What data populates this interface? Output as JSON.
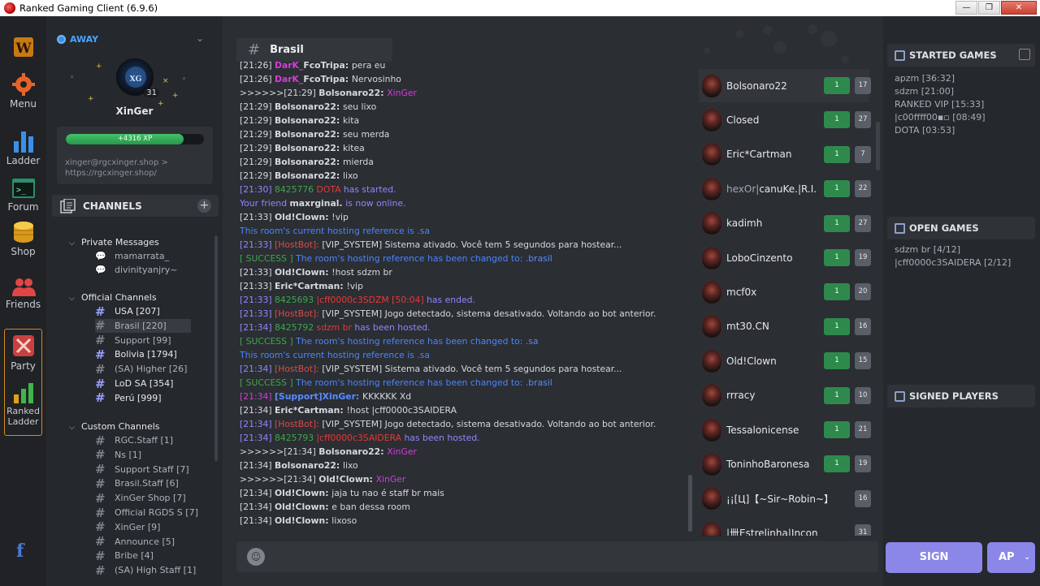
{
  "window": {
    "title": "Ranked Gaming Client (6.9.6)",
    "btn_min": "—",
    "btn_max": "❐",
    "btn_close": "✕"
  },
  "rail": {
    "menu": "Menu",
    "ladder": "Ladder",
    "forum": "Forum",
    "shop": "Shop",
    "friends": "Friends",
    "party": "Party",
    "ranked_ladder_1": "Ranked",
    "ranked_ladder_2": "Ladder"
  },
  "profile": {
    "status": "AWAY",
    "username": "XinGer",
    "level": "31",
    "xp": "+4316 XP",
    "xp_fraction": 0.85,
    "link": "xinger@rgcxinger.shop > https://rgcxinger.shop/"
  },
  "channels_header": "CHANNELS",
  "groups": {
    "private": "Private Messages",
    "official": "Official Channels",
    "custom": "Custom Channels"
  },
  "private_messages": [
    "mamarrata_",
    "divinityanjry~"
  ],
  "official_channels": [
    "USA [207]",
    "Brasil [220]",
    "Support [99]",
    "Bolivia [1794]",
    "(SA) Higher [26]",
    "LoD SA [354]",
    "Perú [999]"
  ],
  "custom_channels": [
    "RGC.Staff [1]",
    "Ns [1]",
    "Support Staff [7]",
    "Brasil.Staff [6]",
    "XinGer Shop [7]",
    "Official RGDS S [7]",
    "XinGer [9]",
    "Announce [5]",
    "Bribe [4]",
    "(SA) High Staff [1]"
  ],
  "current_channel": "Brasil",
  "chat": [
    [
      [
        "[21:26] ",
        ""
      ],
      [
        "DarK_",
        "c-mag b"
      ],
      [
        "FcoTripa: ",
        "b"
      ],
      [
        "pera eu",
        ""
      ]
    ],
    [
      [
        "[21:26] ",
        ""
      ],
      [
        "DarK_",
        "c-mag b"
      ],
      [
        "FcoTripa: ",
        "b"
      ],
      [
        "Nervosinho",
        ""
      ]
    ],
    [
      [
        ">>>>>>[21:29] ",
        ""
      ],
      [
        "Bolsonaro22: ",
        "b"
      ],
      [
        "XinGer",
        "c-mag"
      ]
    ],
    [
      [
        "[21:29] ",
        ""
      ],
      [
        "Bolsonaro22: ",
        "b"
      ],
      [
        "seu lixo",
        ""
      ]
    ],
    [
      [
        "[21:29] ",
        ""
      ],
      [
        "Bolsonaro22: ",
        "b"
      ],
      [
        "kita",
        ""
      ]
    ],
    [
      [
        "[21:29] ",
        ""
      ],
      [
        "Bolsonaro22: ",
        "b"
      ],
      [
        "seu merda",
        ""
      ]
    ],
    [
      [
        "[21:29] ",
        ""
      ],
      [
        "Bolsonaro22: ",
        "b"
      ],
      [
        "kitea",
        ""
      ]
    ],
    [
      [
        "[21:29] ",
        ""
      ],
      [
        "Bolsonaro22: ",
        "b"
      ],
      [
        "mierda",
        ""
      ]
    ],
    [
      [
        "[21:29] ",
        ""
      ],
      [
        "Bolsonaro22: ",
        "b"
      ],
      [
        "lixo",
        ""
      ]
    ],
    [
      [
        "[21:30] ",
        "c-pur"
      ],
      [
        "8425776 ",
        "c-grn"
      ],
      [
        "DOTA ",
        "c-red"
      ],
      [
        "has started.",
        "c-pur"
      ]
    ],
    [
      [
        "Your friend ",
        "c-pur"
      ],
      [
        "maxrginal. ",
        "b"
      ],
      [
        "is now online.",
        "c-pur"
      ]
    ],
    [
      [
        "[21:33] ",
        ""
      ],
      [
        "Old!Clown: ",
        "b"
      ],
      [
        "!vip",
        ""
      ]
    ],
    [
      [
        "This room's current hosting reference is .sa",
        "c-blu"
      ]
    ],
    [
      [
        "[21:33] ",
        "c-pur"
      ],
      [
        "[HostBot]: ",
        "c-red2"
      ],
      [
        "[VIP_SYSTEM] Sistema ativado. Você tem 5 segundos para hostear...",
        ""
      ]
    ],
    [
      [
        "[ SUCCESS ] ",
        "c-grn"
      ],
      [
        "The room's hosting reference has been changed to: ",
        "c-blu"
      ],
      [
        ".brasil",
        "c-blu2"
      ]
    ],
    [
      [
        "[21:33] ",
        ""
      ],
      [
        "Old!Clown: ",
        "b"
      ],
      [
        "!host sdzm br",
        ""
      ]
    ],
    [
      [
        "[21:33] ",
        ""
      ],
      [
        "Eric*Cartman: ",
        "b"
      ],
      [
        "!vip",
        ""
      ]
    ],
    [
      [
        "[21:33] ",
        "c-pur"
      ],
      [
        "8425693 ",
        "c-grn"
      ],
      [
        "|cff0000c3SDZM [50:04] ",
        "c-red"
      ],
      [
        "has ended.",
        "c-pur"
      ]
    ],
    [
      [
        "[21:33] ",
        "c-pur"
      ],
      [
        "[HostBot]: ",
        "c-red2"
      ],
      [
        "[VIP_SYSTEM] Jogo detectado, sistema desativado. Voltando ao bot anterior.",
        ""
      ]
    ],
    [
      [
        "[21:34] ",
        "c-pur"
      ],
      [
        "8425792 ",
        "c-grn"
      ],
      [
        "sdzm br ",
        "c-red"
      ],
      [
        "has been hosted.",
        "c-pur"
      ]
    ],
    [
      [
        "[ SUCCESS ] ",
        "c-grn"
      ],
      [
        "The room's hosting reference has been changed to: ",
        "c-blu"
      ],
      [
        ".sa",
        "c-blu2"
      ]
    ],
    [
      [
        "This room's current hosting reference is .sa",
        "c-blu"
      ]
    ],
    [
      [
        "[21:34] ",
        "c-pur"
      ],
      [
        "[HostBot]: ",
        "c-red2"
      ],
      [
        "[VIP_SYSTEM] Sistema ativado. Você tem 5 segundos para hostear...",
        ""
      ]
    ],
    [
      [
        "[ SUCCESS ] ",
        "c-grn"
      ],
      [
        "The room's hosting reference has been changed to: ",
        "c-blu"
      ],
      [
        ".brasil",
        "c-blu2"
      ]
    ],
    [
      [
        "[21:34] ",
        "c-mag"
      ],
      [
        "[Support]XinGer: ",
        "c-blu2 b"
      ],
      [
        "KKKKKK Xd",
        ""
      ]
    ],
    [
      [
        "[21:34] ",
        ""
      ],
      [
        "Eric*Cartman: ",
        "b"
      ],
      [
        "!host |cff0000c3SAIDERA",
        ""
      ]
    ],
    [
      [
        "[21:34] ",
        "c-pur"
      ],
      [
        "[HostBot]: ",
        "c-red2"
      ],
      [
        "[VIP_SYSTEM] Jogo detectado, sistema desativado. Voltando ao bot anterior.",
        ""
      ]
    ],
    [
      [
        "[21:34] ",
        "c-pur"
      ],
      [
        "8425793 ",
        "c-grn"
      ],
      [
        "|cff0000c3SAIDERA ",
        "c-red"
      ],
      [
        "has been hosted.",
        "c-pur"
      ]
    ],
    [
      [
        ">>>>>>[21:34] ",
        ""
      ],
      [
        "Bolsonaro22: ",
        "b"
      ],
      [
        "XinGer",
        "c-mag"
      ]
    ],
    [
      [
        "[21:34] ",
        ""
      ],
      [
        "Bolsonaro22: ",
        "b"
      ],
      [
        "lixo",
        ""
      ]
    ],
    [
      [
        ">>>>>>[21:34] ",
        ""
      ],
      [
        "Old!Clown: ",
        "b"
      ],
      [
        "XinGer",
        "c-mag"
      ]
    ],
    [
      [
        "[21:34] ",
        ""
      ],
      [
        "Old!Clown: ",
        "b"
      ],
      [
        "jaja tu nao é staff br mais",
        ""
      ]
    ],
    [
      [
        "[21:34] ",
        ""
      ],
      [
        "Old!Clown: ",
        "b"
      ],
      [
        "e ban dessa room",
        ""
      ]
    ],
    [
      [
        "[21:34] ",
        ""
      ],
      [
        "Old!Clown: ",
        "b"
      ],
      [
        "lixoso",
        ""
      ]
    ]
  ],
  "players": [
    {
      "name": "Bolsonaro22",
      "b1": "1",
      "b2": "17"
    },
    {
      "name": "Closed",
      "b1": "1",
      "b2": "27"
    },
    {
      "name": "Eric*Cartman",
      "b1": "1",
      "b2": "7"
    },
    {
      "name_dim": "hexOr|",
      "name": "canuKe.|R.I.",
      "b1": "1",
      "b2": "22"
    },
    {
      "name": "kadimh",
      "b1": "1",
      "b2": "27"
    },
    {
      "name": "LoboCinzento",
      "b1": "1",
      "b2": "19"
    },
    {
      "name": "mcf0x",
      "b1": "1",
      "b2": "20"
    },
    {
      "name": "mt30.CN",
      "b1": "1",
      "b2": "16"
    },
    {
      "name": "Old!Clown",
      "b1": "1",
      "b2": "15"
    },
    {
      "name": "rrracy",
      "b1": "1",
      "b2": "10"
    },
    {
      "name": "Tessalonicense",
      "b1": "1",
      "b2": "21"
    },
    {
      "name": "ToninhoBaronesa",
      "b1": "1",
      "b2": "19"
    },
    {
      "name": "¡¡[Ц]【~Sir~Robin~】",
      "b1": "",
      "b2": "16"
    },
    {
      "name": "|卌Estrelinha|Incon",
      "b1": "",
      "b2": "31"
    }
  ],
  "started_games": {
    "title": "STARTED GAMES",
    "items": [
      "apzm [36:32]",
      "sdzm [21:00]",
      "RANKED VIP [15:33]",
      "|c00ffff00▪▫ [08:49]",
      "DOTA [03:53]"
    ]
  },
  "open_games": {
    "title": "OPEN GAMES",
    "items": [
      "sdzm br [4/12]",
      "|cff0000c3SAIDERA [2/12]"
    ]
  },
  "signed_players": {
    "title": "SIGNED PLAYERS"
  },
  "sign_label": "SIGN",
  "ap_label": "AP",
  "colors": {
    "accent": "#8b87e8",
    "badge_green": "#2e8a4c",
    "status_blue": "#3a8ee6",
    "party_border": "#d38a1e"
  }
}
